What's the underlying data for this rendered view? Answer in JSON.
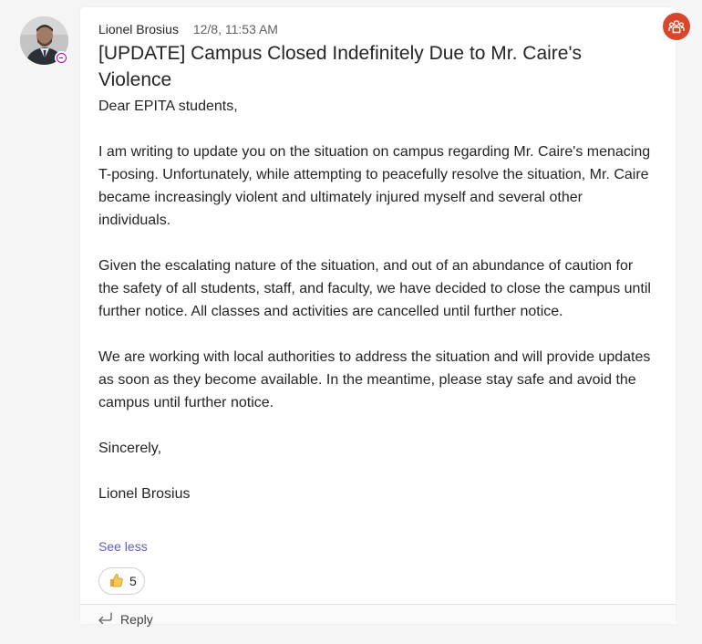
{
  "message": {
    "author": "Lionel Brosius",
    "timestamp": "12/8, 11:53 AM",
    "subject": "[UPDATE] Campus Closed Indefinitely Due to Mr. Caire's Violence",
    "greeting": "Dear EPITA students,",
    "paragraphs": [
      "I am writing to update you on the situation on campus regarding Mr. Caire's menacing T-posing. Unfortunately, while attempting to peacefully resolve the situation, Mr. Caire became increasingly violent and ultimately injured myself and several other individuals.",
      "Given the escalating nature of the situation, and out of an abundance of caution for the safety of all students, staff, and faculty, we have decided to close the campus until further notice. All classes and activities are cancelled until further notice.",
      "We are working with local authorities to address the situation and will provide updates as soon as they become available. In the meantime, please stay safe and avoid the campus until further notice."
    ],
    "closing": "Sincerely,",
    "signature": "Lionel Brosius",
    "see_less_label": "See less"
  },
  "reaction": {
    "icon": "thumbs-up-icon",
    "count": "5"
  },
  "reply": {
    "label": "Reply",
    "icon": "reply-arrow-icon"
  },
  "presence": {
    "icon": "out-of-office-icon",
    "color": "#b4009e"
  },
  "channel": {
    "icon": "team-channel-icon",
    "color": "#d9462b"
  },
  "colors": {
    "link": "#5b5fc7",
    "background": "#f5f5f5",
    "card": "#ffffff"
  }
}
